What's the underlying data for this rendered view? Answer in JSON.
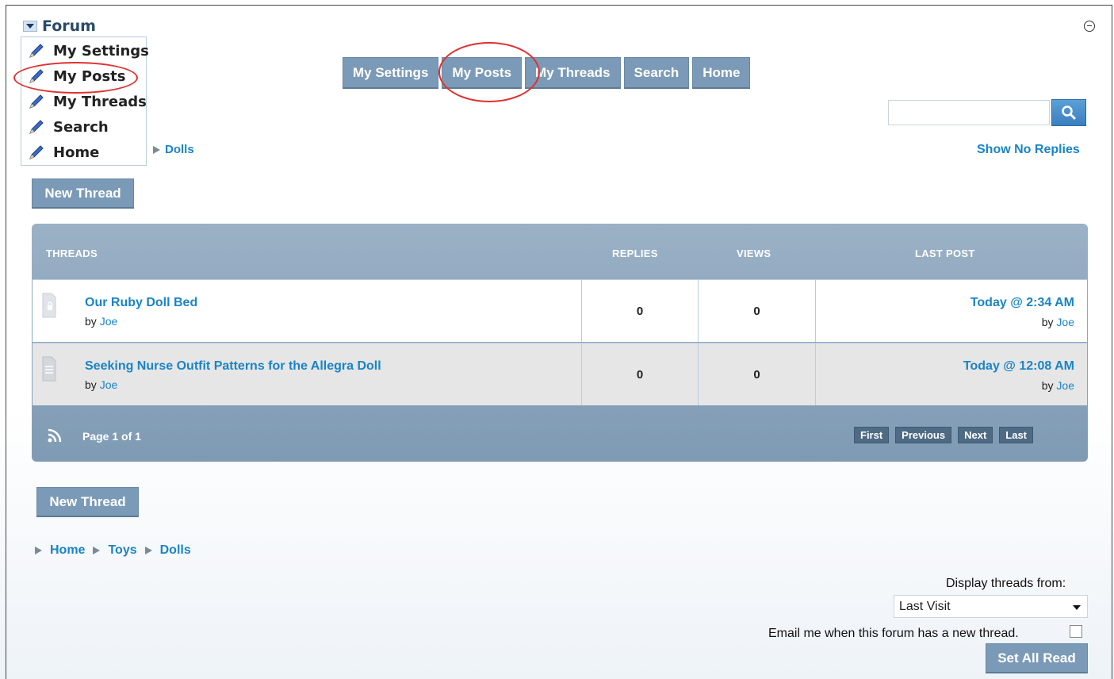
{
  "forum_menu": {
    "title": "Forum",
    "items": [
      {
        "label": "My Settings"
      },
      {
        "label": "My Posts"
      },
      {
        "label": "My Threads"
      },
      {
        "label": "Search"
      },
      {
        "label": "Home"
      }
    ]
  },
  "topnav": {
    "items": [
      "My Settings",
      "My Posts",
      "My Threads",
      "Search",
      "Home"
    ]
  },
  "breadcrumb_top": {
    "current": "Dolls"
  },
  "search": {
    "placeholder": ""
  },
  "show_no_replies": "Show No Replies",
  "new_thread_label": "New Thread",
  "table": {
    "headers": {
      "threads": "THREADS",
      "replies": "REPLIES",
      "views": "VIEWS",
      "last_post": "LAST POST"
    },
    "rows": [
      {
        "title": "Our Ruby Doll Bed",
        "by_prefix": "by",
        "author": "Joe",
        "replies": "0",
        "views": "0",
        "last_date": "Today @ 2:34 AM",
        "last_by_prefix": "by",
        "last_author": "Joe",
        "icon": "locked-document-icon"
      },
      {
        "title": "Seeking Nurse Outfit Patterns for the Allegra Doll",
        "by_prefix": "by",
        "author": "Joe",
        "replies": "0",
        "views": "0",
        "last_date": "Today @ 12:08 AM",
        "last_by_prefix": "by",
        "last_author": "Joe",
        "icon": "document-icon"
      }
    ],
    "footer": {
      "page_info": "Page 1 of 1",
      "pager": [
        "First",
        "Previous",
        "Next",
        "Last"
      ]
    }
  },
  "breadcrumb_bottom": [
    "Home",
    "Toys",
    "Dolls"
  ],
  "display_threads": {
    "label": "Display threads from:",
    "selected": "Last Visit"
  },
  "email_notify": {
    "label": "Email me when this forum has a new thread."
  },
  "set_all_read": "Set All Read",
  "colors": {
    "accent": "#1a84c7",
    "button": "#7b9ab7",
    "annotation": "#e03030"
  }
}
